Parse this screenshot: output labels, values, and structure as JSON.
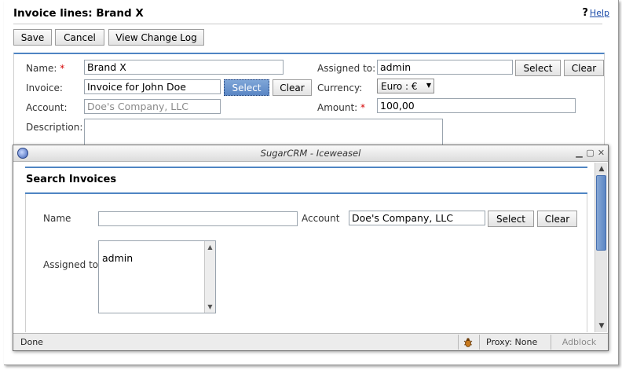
{
  "page": {
    "title": "Invoice lines: Brand X",
    "help_label": "Help"
  },
  "toolbar": {
    "save_label": "Save",
    "cancel_label": "Cancel",
    "changelog_label": "View Change Log"
  },
  "form": {
    "name_label": "Name:",
    "name_value": "Brand X",
    "invoice_label": "Invoice:",
    "invoice_value": "Invoice for John Doe",
    "invoice_select_label": "Select",
    "invoice_clear_label": "Clear",
    "account_label": "Account:",
    "account_value": "Doe's Company, LLC",
    "description_label": "Description:",
    "assigned_label": "Assigned to:",
    "assigned_value": "admin",
    "assigned_select_label": "Select",
    "assigned_clear_label": "Clear",
    "currency_label": "Currency:",
    "currency_value": "Euro : €",
    "amount_label": "Amount:",
    "amount_value": "100,00",
    "required_marker": "*"
  },
  "popup": {
    "window_title": "SugarCRM - Iceweasel",
    "search_title": "Search Invoices",
    "name_label": "Name",
    "name_value": "",
    "account_label": "Account",
    "account_value": "Doe's Company, LLC",
    "select_label": "Select",
    "clear_label": "Clear",
    "assigned_label": "Assigned to",
    "assigned_options": [
      "admin"
    ],
    "status": {
      "done": "Done",
      "proxy": "Proxy: None",
      "adblock": "Adblock"
    }
  },
  "icons": {
    "help": "question-mark-icon",
    "app": "iceweasel-icon",
    "minimize": "minimize-icon",
    "maximize": "maximize-icon",
    "close": "close-icon",
    "firebug": "bug-icon"
  },
  "colors": {
    "accent": "#4f85c3",
    "required": "#d40000",
    "link": "#1a4aa8",
    "active_button": "#5a86c5"
  }
}
